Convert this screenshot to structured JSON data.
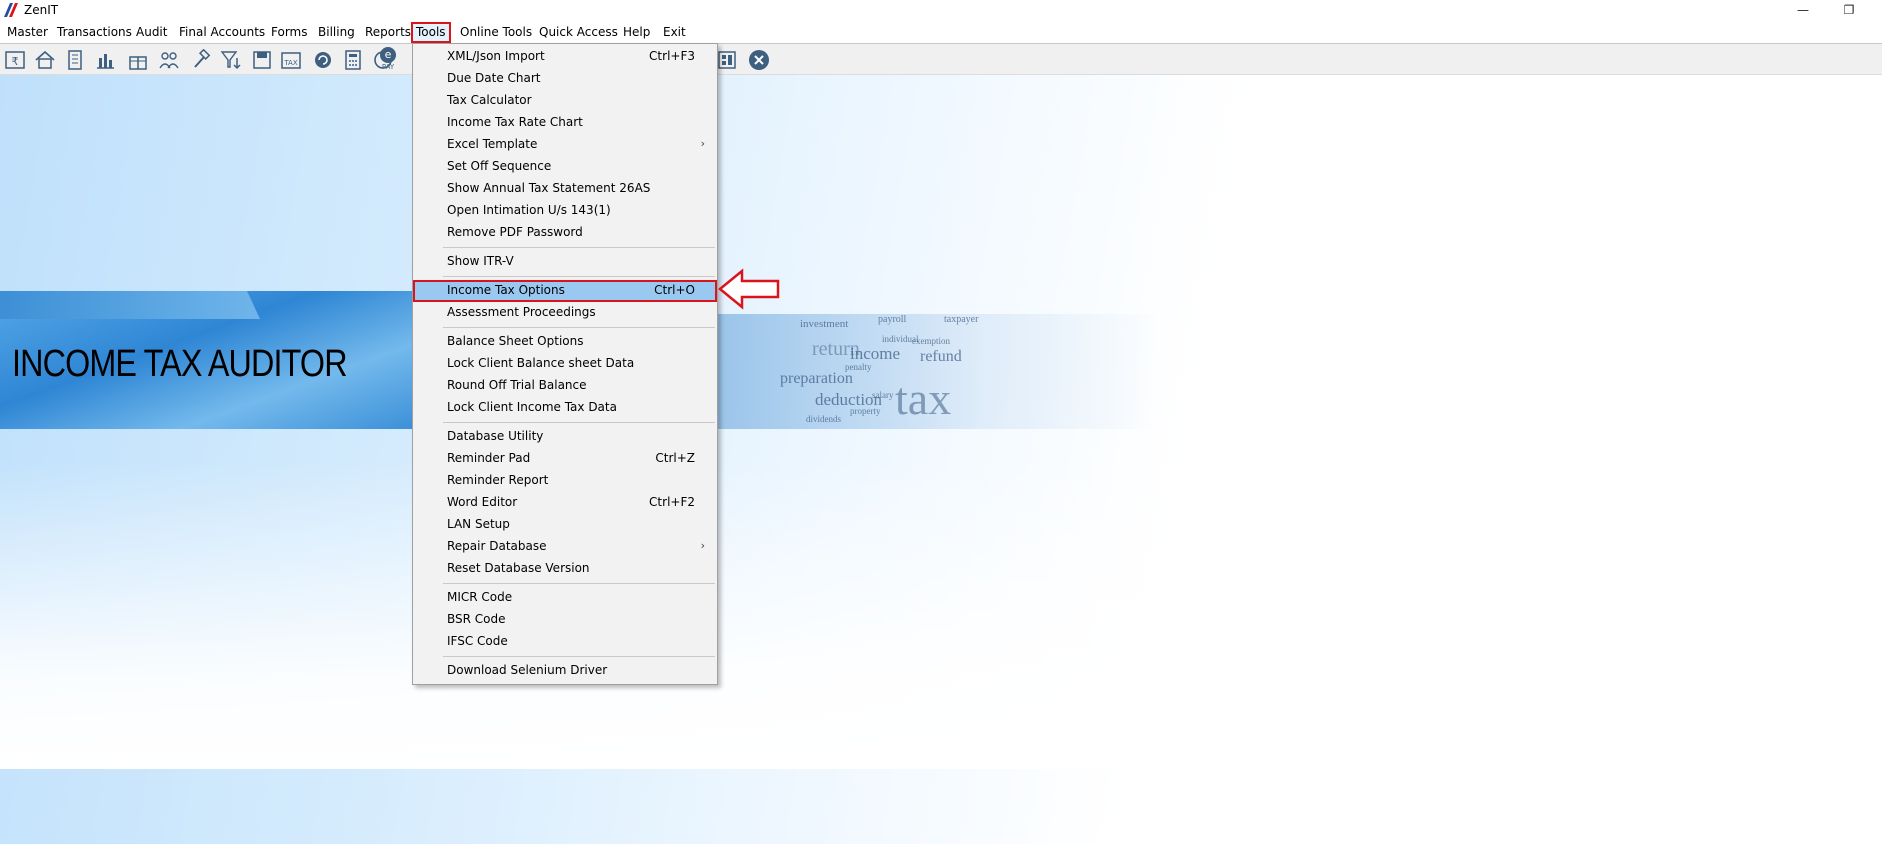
{
  "window": {
    "title": "ZenIT",
    "minimize_glyph": "—",
    "restore_glyph": "❐"
  },
  "menubar": {
    "items": [
      {
        "label": "Master"
      },
      {
        "label": "Transactions"
      },
      {
        "label": "Audit"
      },
      {
        "label": "Final Accounts"
      },
      {
        "label": "Forms"
      },
      {
        "label": "Billing"
      },
      {
        "label": "Reports"
      },
      {
        "label": "Tools"
      },
      {
        "label": "Online Tools"
      },
      {
        "label": "Quick Access"
      },
      {
        "label": "Help"
      },
      {
        "label": "Exit"
      }
    ],
    "active": "Tools"
  },
  "toolbar": {
    "icons": [
      "rupee-book-icon",
      "home-icon",
      "building-icon",
      "bar-chart-icon",
      "gift-icon",
      "users-icon",
      "hammer-icon",
      "filter-download-icon",
      "save-icon",
      "tax-icon",
      "refresh-icon",
      "calculator-icon",
      "pie-chart-icon",
      "e-pay-icon",
      "dashboard-icon",
      "close-circle-icon"
    ],
    "tax_icon_text": "TAX",
    "pay_icon_text": "PAY",
    "e_icon_text": "e"
  },
  "banner": {
    "title": "INCOME TAX AUDITOR",
    "words": [
      "investment",
      "payroll",
      "taxpayer",
      "income",
      "refund",
      "preparation",
      "deduction",
      "tax",
      "penalty",
      "individual",
      "exemption",
      "salary",
      "dividends",
      "property",
      "return"
    ]
  },
  "dropdown": {
    "items": [
      {
        "label": "XML/Json Import",
        "shortcut": "Ctrl+F3"
      },
      {
        "label": "Due Date Chart",
        "shortcut": ""
      },
      {
        "label": "Tax Calculator",
        "shortcut": ""
      },
      {
        "label": "Income Tax Rate Chart",
        "shortcut": ""
      },
      {
        "label": "Excel Template",
        "shortcut": "",
        "submenu": true
      },
      {
        "label": "Set Off Sequence",
        "shortcut": ""
      },
      {
        "label": "Show Annual Tax Statement 26AS",
        "shortcut": ""
      },
      {
        "label": "Open Intimation U/s 143(1)",
        "shortcut": ""
      },
      {
        "label": "Remove PDF Password",
        "shortcut": ""
      },
      {
        "separator": true
      },
      {
        "label": "Show ITR-V",
        "shortcut": ""
      },
      {
        "separator": true
      },
      {
        "label": "Income Tax Options",
        "shortcut": "Ctrl+O",
        "highlight": true
      },
      {
        "label": "Assessment Proceedings",
        "shortcut": ""
      },
      {
        "separator": true
      },
      {
        "label": "Balance Sheet Options",
        "shortcut": ""
      },
      {
        "label": "Lock Client Balance sheet Data",
        "shortcut": ""
      },
      {
        "label": "Round Off Trial Balance",
        "shortcut": ""
      },
      {
        "label": "Lock Client Income Tax Data",
        "shortcut": ""
      },
      {
        "separator": true
      },
      {
        "label": "Database Utility",
        "shortcut": ""
      },
      {
        "label": "Reminder Pad",
        "shortcut": "Ctrl+Z"
      },
      {
        "label": "Reminder Report",
        "shortcut": ""
      },
      {
        "label": "Word Editor",
        "shortcut": "Ctrl+F2"
      },
      {
        "label": "LAN Setup",
        "shortcut": ""
      },
      {
        "label": "Repair Database",
        "shortcut": "",
        "submenu": true
      },
      {
        "label": "Reset Database Version",
        "shortcut": ""
      },
      {
        "separator": true
      },
      {
        "label": "MICR Code",
        "shortcut": ""
      },
      {
        "label": "BSR Code",
        "shortcut": ""
      },
      {
        "label": "IFSC Code",
        "shortcut": ""
      },
      {
        "separator": true
      },
      {
        "label": "Download Selenium Driver",
        "shortcut": ""
      }
    ]
  },
  "colors": {
    "highlight_row": "#99c9f1",
    "annotation_red": "#d9141c",
    "menu_bg": "#f2f2f2"
  }
}
